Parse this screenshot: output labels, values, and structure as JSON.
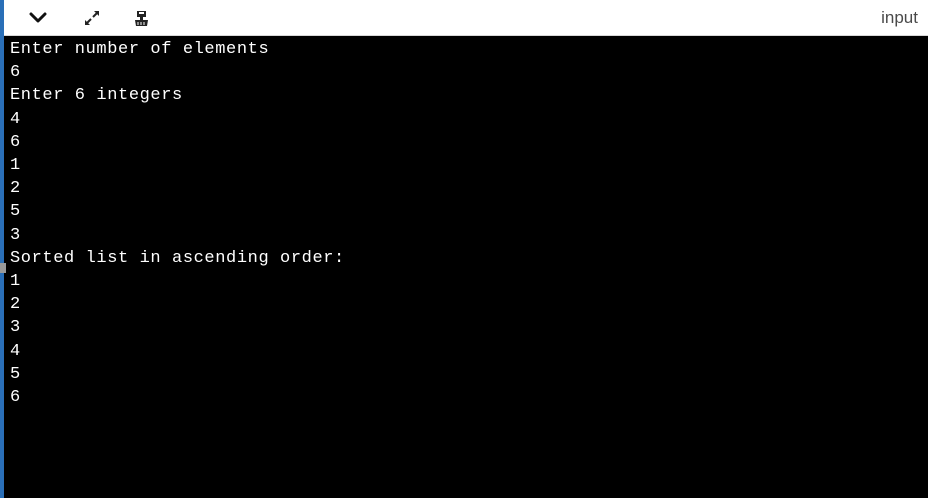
{
  "toolbar": {
    "tab_label": "input",
    "buttons": [
      {
        "name": "collapse",
        "icon": "chevron-down-icon"
      },
      {
        "name": "expand",
        "icon": "expand-icon"
      },
      {
        "name": "clear",
        "icon": "clear-console-icon"
      }
    ]
  },
  "console": {
    "lines": [
      "Enter number of elements",
      "6",
      "Enter 6 integers",
      "4",
      "6",
      "1",
      "2",
      "5",
      "3",
      "Sorted list in ascending order:",
      "1",
      "2",
      "3",
      "4",
      "5",
      "6"
    ]
  },
  "colors": {
    "console_background": "#000000",
    "console_text": "#ffffff",
    "accent_bar": "#2a6fb8",
    "tab_text": "#4a4a4a"
  }
}
